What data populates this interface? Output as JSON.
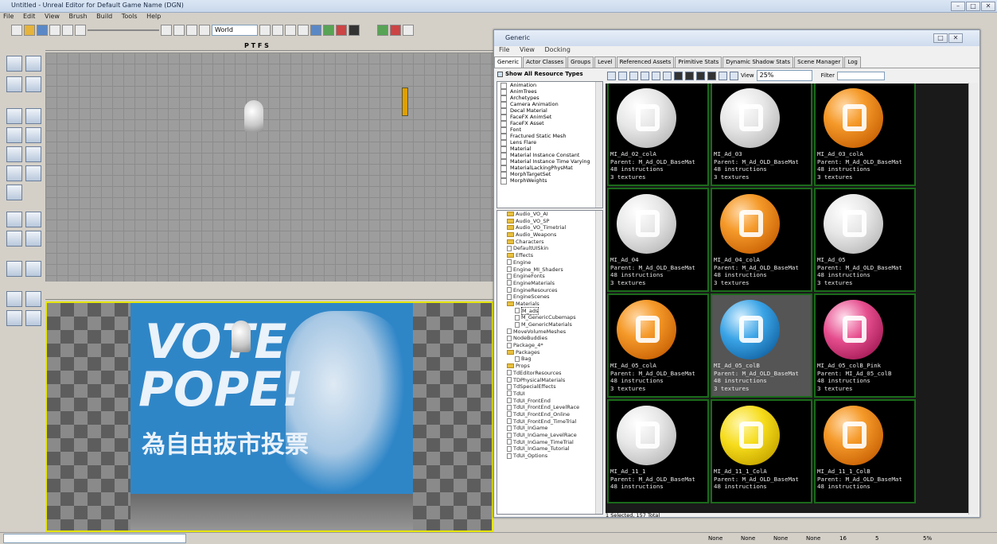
{
  "titlebar": {
    "title": "Untitled - Unreal Editor for Default Game Name (DGN)"
  },
  "menubar": [
    "File",
    "Edit",
    "View",
    "Brush",
    "Build",
    "Tools",
    "Help"
  ],
  "toolbar": {
    "coord_system": "World",
    "viewport_mode_letters": [
      "P",
      "T",
      "F",
      "S"
    ]
  },
  "viewport_top": {
    "label_letters": "P T F S"
  },
  "viewport_persp": {
    "poster_text": [
      "VOTE",
      "POPE!",
      "為自由抜市投票"
    ]
  },
  "browser": {
    "title": "Generic",
    "menu": [
      "File",
      "View",
      "Docking"
    ],
    "tabs": [
      "Generic",
      "Actor Classes",
      "Groups",
      "Level",
      "Referenced Assets",
      "Primitive Stats",
      "Dynamic Shadow Stats",
      "Scene Manager",
      "Log"
    ],
    "show_all_label": "Show All Resource Types",
    "resource_types": [
      "Animation",
      "AnimTrees",
      "Archetypes",
      "Camera Animation",
      "Decal Material",
      "FaceFX AnimSet",
      "FaceFX Asset",
      "Font",
      "Fractured Static Mesh",
      "Lens Flare",
      "Material",
      "Material Instance Constant",
      "Material Instance Time Varying",
      "MaterialLackingPhysMat",
      "MorphTargetSet",
      "MorphWeights"
    ],
    "packages": [
      {
        "label": "Audio_VO_AI",
        "type": "folder",
        "depth": 0
      },
      {
        "label": "Audio_VO_SP",
        "type": "folder",
        "depth": 0
      },
      {
        "label": "Audio_VO_Timetrial",
        "type": "folder",
        "depth": 0
      },
      {
        "label": "Audio_Weapons",
        "type": "folder",
        "depth": 0
      },
      {
        "label": "Characters",
        "type": "folder",
        "depth": 0
      },
      {
        "label": "DefaultUISkin",
        "type": "package",
        "depth": 0
      },
      {
        "label": "Effects",
        "type": "folder",
        "depth": 0
      },
      {
        "label": "Engine",
        "type": "package",
        "depth": 0
      },
      {
        "label": "Engine_MI_Shaders",
        "type": "package",
        "depth": 0
      },
      {
        "label": "EngineFonts",
        "type": "package",
        "depth": 0
      },
      {
        "label": "EngineMaterials",
        "type": "package",
        "depth": 0
      },
      {
        "label": "EngineResources",
        "type": "package",
        "depth": 0
      },
      {
        "label": "EngineScenes",
        "type": "package",
        "depth": 0
      },
      {
        "label": "Materials",
        "type": "folder",
        "depth": 0
      },
      {
        "label": "M_ads",
        "type": "package",
        "depth": 1
      },
      {
        "label": "M_GenericCubemaps",
        "type": "package",
        "depth": 1
      },
      {
        "label": "M_GenericMaterials",
        "type": "package",
        "depth": 1
      },
      {
        "label": "MoveVolumeMeshes",
        "type": "package",
        "depth": 0
      },
      {
        "label": "NodeBuddies",
        "type": "package",
        "depth": 0
      },
      {
        "label": "Package_4*",
        "type": "package",
        "depth": 0
      },
      {
        "label": "Packages",
        "type": "folder",
        "depth": 0
      },
      {
        "label": "Bag",
        "type": "package",
        "depth": 1
      },
      {
        "label": "Props",
        "type": "folder",
        "depth": 0
      },
      {
        "label": "TdEditorResources",
        "type": "package",
        "depth": 0
      },
      {
        "label": "TDPhysicalMaterials",
        "type": "package",
        "depth": 0
      },
      {
        "label": "TdSpecialEffects",
        "type": "package",
        "depth": 0
      },
      {
        "label": "TdUI",
        "type": "package",
        "depth": 0
      },
      {
        "label": "TdUI_FrontEnd",
        "type": "package",
        "depth": 0
      },
      {
        "label": "TdUI_FrontEnd_LevelRace",
        "type": "package",
        "depth": 0
      },
      {
        "label": "TdUI_FrontEnd_Online",
        "type": "package",
        "depth": 0
      },
      {
        "label": "TdUI_FrontEnd_TimeTrial",
        "type": "package",
        "depth": 0
      },
      {
        "label": "TdUI_InGame",
        "type": "package",
        "depth": 0
      },
      {
        "label": "TdUI_InGame_LevelRace",
        "type": "package",
        "depth": 0
      },
      {
        "label": "TdUI_InGame_TimeTrial",
        "type": "package",
        "depth": 0
      },
      {
        "label": "TdUI_InGame_Tutorial",
        "type": "package",
        "depth": 0
      },
      {
        "label": "TdUI_Options",
        "type": "package",
        "depth": 0
      }
    ],
    "view_label": "View",
    "zoom": "25%",
    "filter_label": "Filter",
    "filter_value": "",
    "status": "1 Selected, 157 Total",
    "assets": [
      {
        "name": "MI_Ad_02_colA",
        "parent": "Parent: M_Ad_OLD_BaseMat",
        "instructions": "48 instructions",
        "textures": "3 textures",
        "color": "white",
        "selected": false
      },
      {
        "name": "MI_Ad_03",
        "parent": "Parent: M_Ad_OLD_BaseMat",
        "instructions": "48 instructions",
        "textures": "3 textures",
        "color": "white",
        "selected": false
      },
      {
        "name": "MI_Ad_03_colA",
        "parent": "Parent: M_Ad_OLD_BaseMat",
        "instructions": "48 instructions",
        "textures": "3 textures",
        "color": "orange",
        "selected": false
      },
      {
        "name": "MI_Ad_04",
        "parent": "Parent: M_Ad_OLD_BaseMat",
        "instructions": "48 instructions",
        "textures": "3 textures",
        "color": "white",
        "selected": false
      },
      {
        "name": "MI_Ad_04_colA",
        "parent": "Parent: M_Ad_OLD_BaseMat",
        "instructions": "48 instructions",
        "textures": "3 textures",
        "color": "orange",
        "selected": false
      },
      {
        "name": "MI_Ad_05",
        "parent": "Parent: M_Ad_OLD_BaseMat",
        "instructions": "48 instructions",
        "textures": "3 textures",
        "color": "white",
        "selected": false
      },
      {
        "name": "MI_Ad_05_colA",
        "parent": "Parent: M_Ad_OLD_BaseMat",
        "instructions": "48 instructions",
        "textures": "3 textures",
        "color": "orange",
        "selected": false
      },
      {
        "name": "MI_Ad_05_colB",
        "parent": "Parent: M_Ad_OLD_BaseMat",
        "instructions": "48 instructions",
        "textures": "3 textures",
        "color": "blue",
        "selected": true
      },
      {
        "name": "MI_Ad_05_colB_Pink",
        "parent": "Parent: MI_Ad_05_colB",
        "instructions": "48 instructions",
        "textures": "3 textures",
        "color": "pink",
        "selected": false
      },
      {
        "name": "MI_Ad_11_1",
        "parent": "Parent: M_Ad_OLD_BaseMat",
        "instructions": "48 instructions",
        "textures": "",
        "color": "white",
        "selected": false
      },
      {
        "name": "MI_Ad_11_1_ColA",
        "parent": "Parent: M_Ad_OLD_BaseMat",
        "instructions": "48 instructions",
        "textures": "",
        "color": "yellow",
        "selected": false
      },
      {
        "name": "MI_Ad_11_1_ColB",
        "parent": "Parent: M_Ad_OLD_BaseMat",
        "instructions": "48 instructions",
        "textures": "",
        "color": "orange",
        "selected": false
      }
    ]
  },
  "statusbar": {
    "fields": [
      "None",
      "None",
      "None",
      "None"
    ],
    "grid_size": "16",
    "rot_snap": "5",
    "scale_snap": "5%"
  }
}
